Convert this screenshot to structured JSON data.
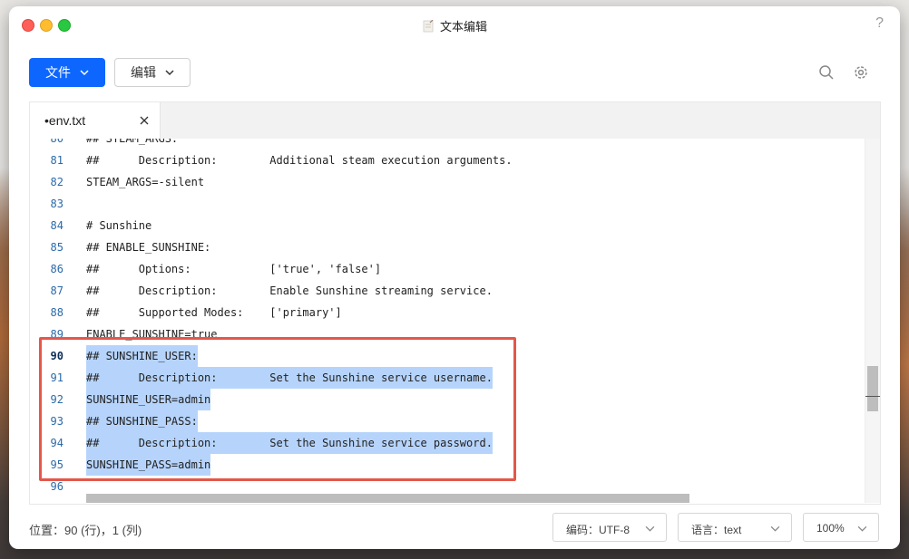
{
  "window": {
    "title": "文本编辑",
    "help": "?"
  },
  "toolbar": {
    "file_label": "文件",
    "edit_label": "编辑"
  },
  "tab": {
    "name": "env.txt",
    "modified_marker": "•"
  },
  "code_lines": [
    {
      "num": "80",
      "text": "## STEAM_ARGS:",
      "selected": false
    },
    {
      "num": "81",
      "text": "##      Description:        Additional steam execution arguments.",
      "selected": false
    },
    {
      "num": "82",
      "text": "STEAM_ARGS=-silent",
      "selected": false
    },
    {
      "num": "83",
      "text": "",
      "selected": false
    },
    {
      "num": "84",
      "text": "# Sunshine",
      "selected": false
    },
    {
      "num": "85",
      "text": "## ENABLE_SUNSHINE:",
      "selected": false
    },
    {
      "num": "86",
      "text": "##      Options:            ['true', 'false']",
      "selected": false
    },
    {
      "num": "87",
      "text": "##      Description:        Enable Sunshine streaming service.",
      "selected": false
    },
    {
      "num": "88",
      "text": "##      Supported Modes:    ['primary']",
      "selected": false
    },
    {
      "num": "89",
      "text": "ENABLE_SUNSHINE=true",
      "selected": false
    },
    {
      "num": "90",
      "text": "## SUNSHINE_USER:",
      "selected": true,
      "current": true
    },
    {
      "num": "91",
      "text": "##      Description:        Set the Sunshine service username.",
      "selected": true
    },
    {
      "num": "92",
      "text": "SUNSHINE_USER=admin",
      "selected": true
    },
    {
      "num": "93",
      "text": "## SUNSHINE_PASS:",
      "selected": true
    },
    {
      "num": "94",
      "text": "##      Description:        Set the Sunshine service password.",
      "selected": true
    },
    {
      "num": "95",
      "text": "SUNSHINE_PASS=admin",
      "selected": true
    },
    {
      "num": "96",
      "text": "",
      "selected": false
    }
  ],
  "status": {
    "position": "位置：90 (行)，1 (列)",
    "encoding": "编码：UTF-8",
    "language": "语言：text",
    "zoom": "100%"
  },
  "colors": {
    "accent": "#0d67ff",
    "selection": "#b6d4fb",
    "highlight_box": "#e3574a"
  },
  "icons": [
    "search-icon",
    "gear-icon",
    "close-icon",
    "chevron-down-icon",
    "note-icon"
  ]
}
